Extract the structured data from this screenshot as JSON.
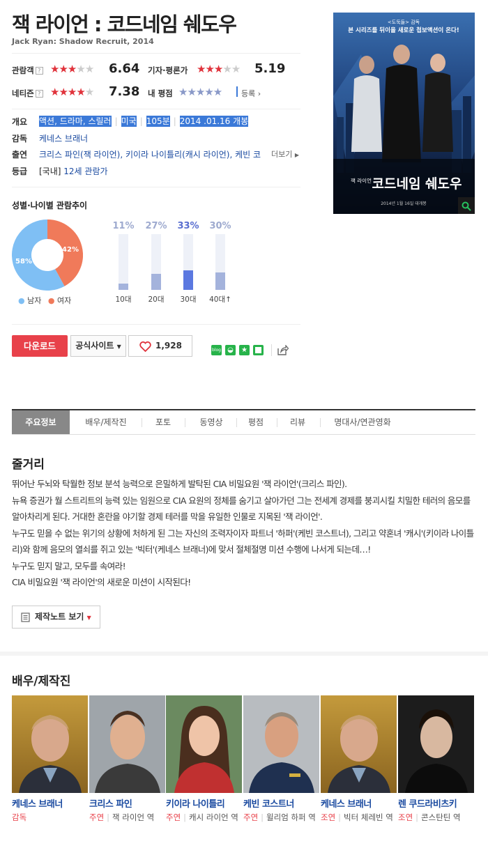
{
  "movie": {
    "title": "잭 라이언 : 코드네임 쉐도우",
    "original_title": "Jack Ryan: Shadow Recruit, 2014"
  },
  "ratings": {
    "audience_label": "관람객",
    "audience_score": "6.64",
    "audience_stars": 3.3,
    "critic_label": "기자·평론가",
    "critic_score": "5.19",
    "critic_stars": 2.6,
    "netizen_label": "네티즌",
    "netizen_score": "7.38",
    "netizen_stars": 3.7,
    "my_label": "내 평점",
    "my_register": "등록",
    "help_mark": "?"
  },
  "info": {
    "overview_label": "개요",
    "genre": "액션, 드라마, 스릴러",
    "country": "미국",
    "runtime": "105분",
    "release": "2014 .01.16 개봉",
    "director_label": "감독",
    "director": "케네스 브래너",
    "cast_label": "출연",
    "cast": "크리스 파인(잭 라이언), 키이라 나이틀리(캐시 라이언), 케빈 코...",
    "cast_more": "더보기",
    "grade_label": "등급",
    "grade_prefix": "[국내]",
    "grade": "12세 관람가"
  },
  "trend": {
    "title": "성별·나이별 관람추이",
    "male_pct": "58%",
    "female_pct": "42%",
    "male_value": 58,
    "female_value": 42,
    "male_label": "남자",
    "female_label": "여자",
    "male_color": "#7fbff4",
    "female_color": "#f07a5a",
    "ages": [
      {
        "pct": "11%",
        "value": 11,
        "label": "10대",
        "highlight": false
      },
      {
        "pct": "27%",
        "value": 27,
        "label": "20대",
        "highlight": false
      },
      {
        "pct": "33%",
        "value": 33,
        "label": "30대",
        "highlight": true
      },
      {
        "pct": "30%",
        "value": 30,
        "label": "40대↑",
        "highlight": false
      }
    ]
  },
  "actions": {
    "download": "다운로드",
    "official_site": "공식사이트",
    "likes": "1,928"
  },
  "poster": {
    "tagline_top": "<도둑들> 감독",
    "tagline": "본 시리즈를 뒤이을 새로운 첩보액션이 온다!",
    "title_small": "잭 라이언",
    "title_big": "코드네임 쉐도우",
    "date": "2014년 1월 16일 대개봉"
  },
  "tabs": [
    "주요정보",
    "배우/제작진",
    "포토",
    "동영상",
    "평점",
    "리뷰",
    "명대사/연관영화"
  ],
  "story": {
    "heading": "줄거리",
    "lines": [
      "뛰어난 두뇌와 탁월한 정보 분석 능력으로 은밀하게 발탁된 CIA 비밀요원 '잭 라이언'(크리스 파인).",
      " 뉴욕 증권가 월 스트리트의 능력 있는 임원으로 CIA 요원의 정체를 숨기고 살아가던 그는 전세계 경제를 붕괴시킬 치밀한 테러의 음모를 알아차리게 된다. 거대한 혼란을 야기할 경제 테러를 막을 유일한 인물로 지목된 '잭 라이언'.",
      " 누구도 믿을 수 없는 위기의 상황에 처하게 된 그는 자신의 조력자이자 파트너 '하퍼'(케빈 코스트너), 그리고 약혼녀 '캐시'(키이라 나이틀리)와 함께 음모의 열쇠를 쥐고 있는 '빅터'(케네스 브래너)에 맞서 절체절명 미션 수행에 나서게 되는데…!",
      " 누구도 믿지 말고, 모두를 속여라!",
      " CIA 비밀요원 '잭 라이언'의 새로운 미션이 시작된다!"
    ],
    "note_button": "제작노트 보기"
  },
  "cast_section": {
    "heading": "배우/제작진",
    "people": [
      {
        "name": "케네스 브래너",
        "type": "감독",
        "role": ""
      },
      {
        "name": "크리스 파인",
        "type": "주연",
        "role": "잭 라이언 역"
      },
      {
        "name": "키이라 나이틀리",
        "type": "주연",
        "role": "캐시 라이언 역"
      },
      {
        "name": "케빈 코스트너",
        "type": "주연",
        "role": "윌리엄 하퍼 역"
      },
      {
        "name": "케네스 브래너",
        "type": "조연",
        "role": "빅터 체레빈 역"
      },
      {
        "name": "렌 쿠드라비츠키",
        "type": "조연",
        "role": "콘스탄틴 역"
      }
    ]
  }
}
